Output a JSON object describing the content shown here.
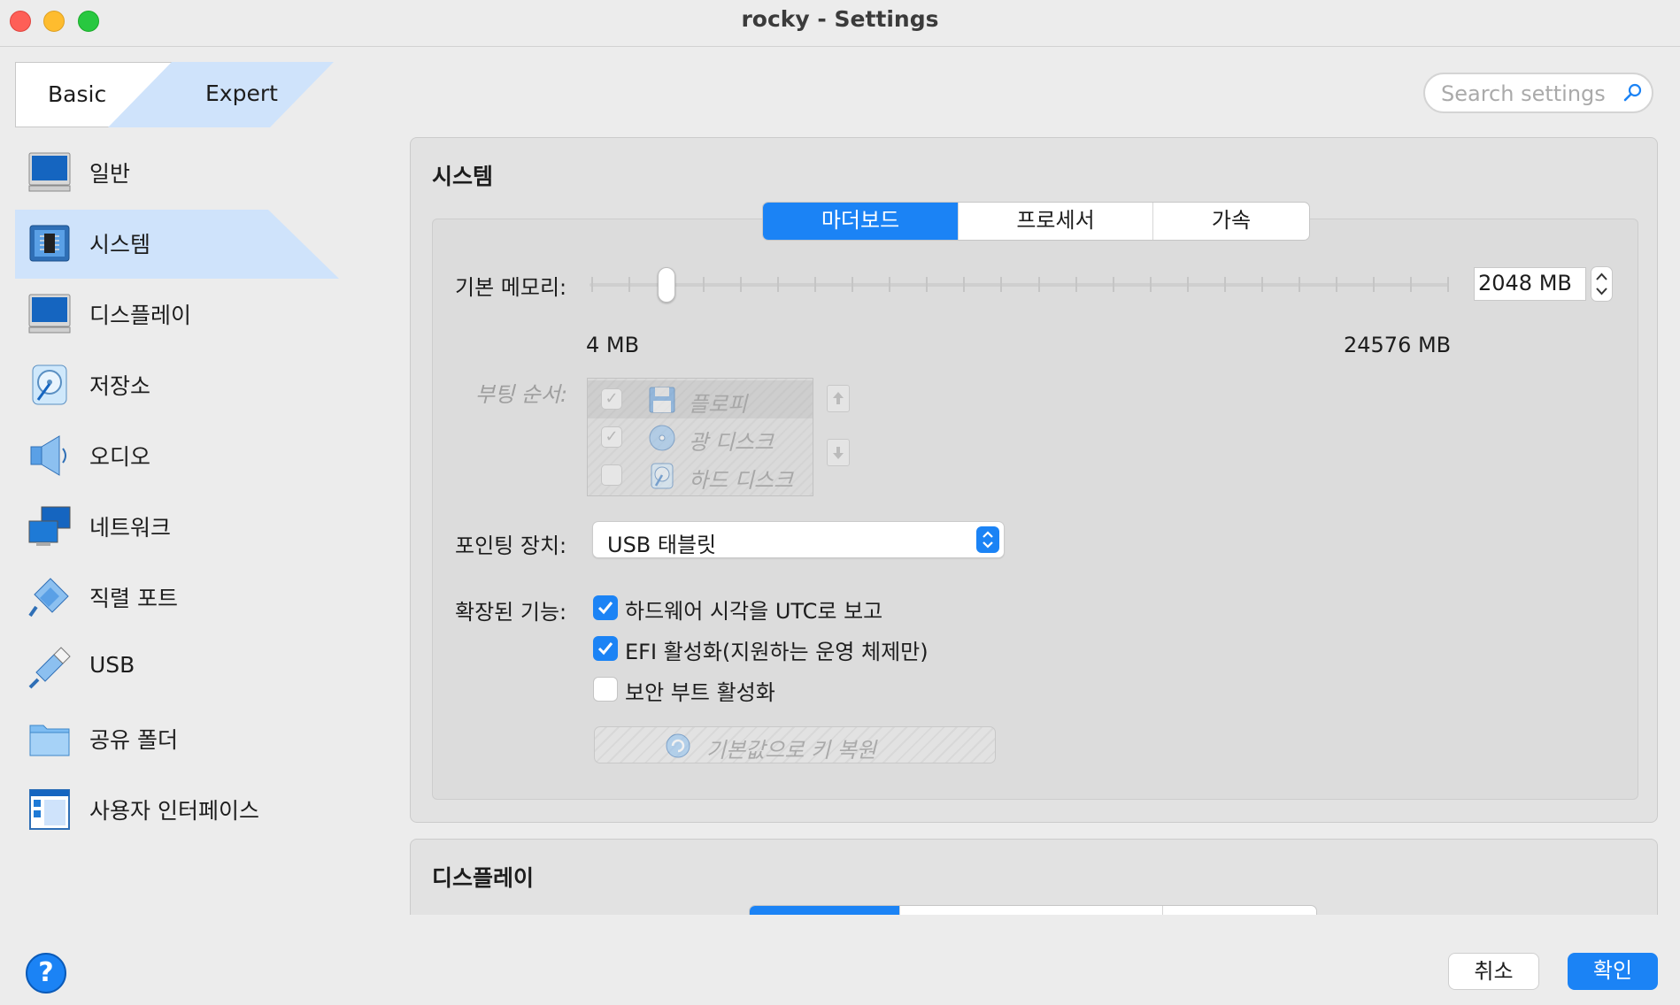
{
  "window": {
    "title": "rocky - Settings"
  },
  "mode": {
    "basic": "Basic",
    "expert": "Expert",
    "selected": "Expert"
  },
  "search": {
    "placeholder": "Search settings"
  },
  "sidebar": {
    "items": [
      {
        "label": "일반",
        "icon": "general-monitor-icon"
      },
      {
        "label": "시스템",
        "icon": "system-chip-icon",
        "selected": true
      },
      {
        "label": "디스플레이",
        "icon": "display-monitor-icon"
      },
      {
        "label": "저장소",
        "icon": "storage-disk-icon"
      },
      {
        "label": "오디오",
        "icon": "speaker-icon"
      },
      {
        "label": "네트워크",
        "icon": "network-icon"
      },
      {
        "label": "직렬 포트",
        "icon": "serial-port-icon"
      },
      {
        "label": "USB",
        "icon": "usb-icon"
      },
      {
        "label": "공유 폴더",
        "icon": "folder-icon"
      },
      {
        "label": "사용자 인터페이스",
        "icon": "user-interface-icon"
      }
    ]
  },
  "system": {
    "title": "시스템",
    "tabs": [
      "마더보드",
      "프로세서",
      "가속"
    ],
    "active_tab": "마더보드",
    "memory": {
      "label": "기본 메모리:",
      "value": "2048 MB",
      "min_label": "4 MB",
      "max_label": "24576 MB",
      "min": 4,
      "max": 24576,
      "current": 2048
    },
    "boot": {
      "label": "부팅 순서:",
      "items": [
        {
          "label": "플로피",
          "checked": true,
          "icon": "floppy-icon"
        },
        {
          "label": "광 디스크",
          "checked": true,
          "icon": "optical-disc-icon"
        },
        {
          "label": "하드 디스크",
          "checked": false,
          "icon": "hard-disk-icon"
        }
      ]
    },
    "pointing": {
      "label": "포인팅 장치:",
      "value": "USB 태블릿"
    },
    "extended": {
      "label": "확장된 기능:",
      "options": [
        {
          "label": "하드웨어 시각을 UTC로 보고",
          "checked": true
        },
        {
          "label": "EFI 활성화(지원하는 운영 체제만)",
          "checked": true
        },
        {
          "label": "보안 부트 활성화",
          "checked": false
        }
      ],
      "restore_label": "기본값으로 키 복원"
    }
  },
  "display": {
    "title": "디스플레이"
  },
  "footer": {
    "help": "?",
    "cancel": "취소",
    "ok": "확인"
  },
  "colors": {
    "accent": "#1b83f5",
    "selection": "#cfe3fb"
  }
}
